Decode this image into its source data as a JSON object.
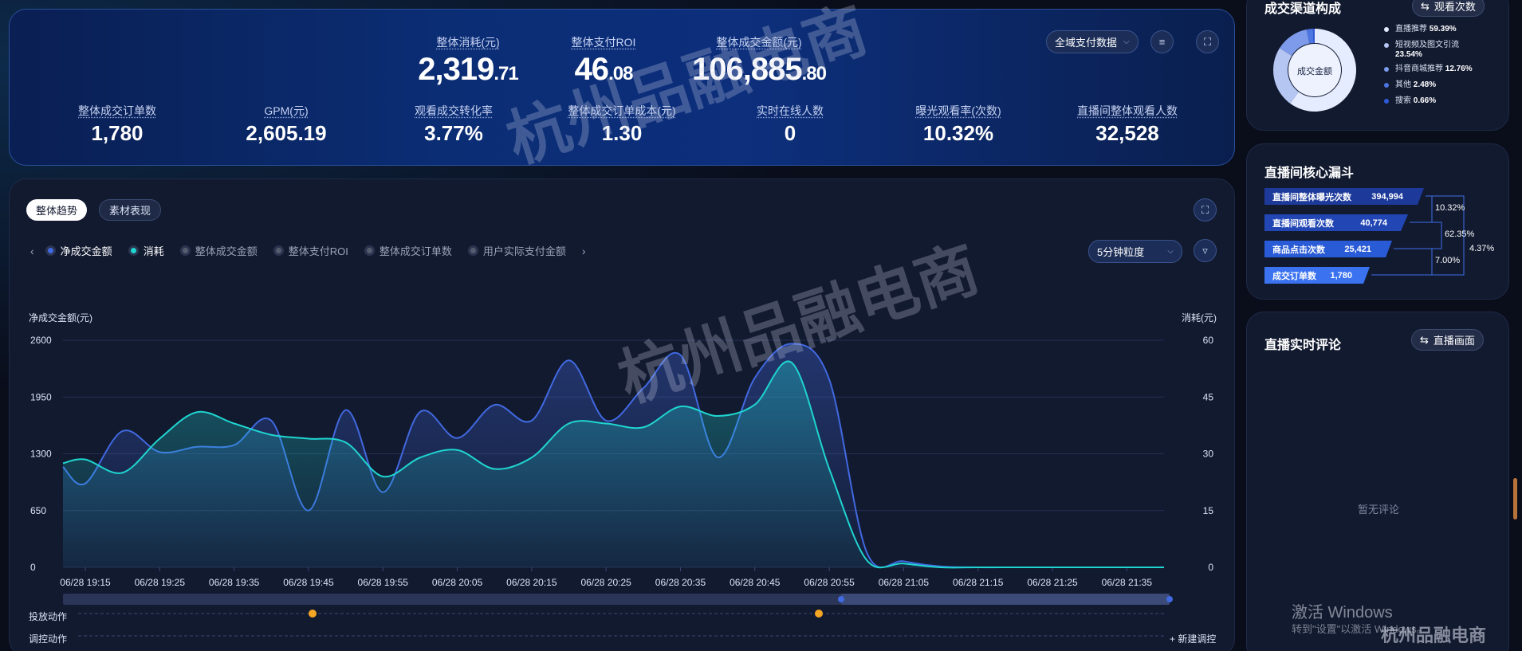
{
  "kpi": {
    "hero": [
      {
        "label": "整体消耗(元)",
        "int": "2,319",
        "dec": ".71"
      },
      {
        "label": "整体支付ROI",
        "int": "46",
        "dec": ".08"
      },
      {
        "label": "整体成交金额(元)",
        "int": "106,885",
        "dec": ".80"
      }
    ],
    "metrics": [
      {
        "label": "整体成交订单数",
        "value": "1,780"
      },
      {
        "label": "GPM(元)",
        "value": "2,605.19"
      },
      {
        "label": "观看成交转化率",
        "value": "3.77%"
      },
      {
        "label": "整体成交订单成本(元)",
        "value": "1.30"
      },
      {
        "label": "实时在线人数",
        "value": "0"
      },
      {
        "label": "曝光观看率(次数)",
        "value": "10.32%"
      },
      {
        "label": "直播间整体观看人数",
        "value": "32,528"
      }
    ],
    "scope_dropdown": "全域支付数据"
  },
  "trend": {
    "tabs": [
      "整体趋势",
      "素材表现"
    ],
    "legend": [
      {
        "name": "净成交金额",
        "color": "#4169e1",
        "active": true
      },
      {
        "name": "消耗",
        "color": "#1fd5d0",
        "active": true
      },
      {
        "name": "整体成交金额",
        "color": "#555c6e",
        "active": false
      },
      {
        "name": "整体支付ROI",
        "color": "#555c6e",
        "active": false
      },
      {
        "name": "整体成交订单数",
        "color": "#555c6e",
        "active": false
      },
      {
        "name": "用户实际支付金额",
        "color": "#555c6e",
        "active": false
      }
    ],
    "granularity": "5分钟粒度",
    "action_rows": [
      "投放动作",
      "调控动作"
    ],
    "new_adjust": "新建调控"
  },
  "chart_data": {
    "type": "line",
    "title": "",
    "ylabel_left": "净成交金额(元)",
    "ylabel_right": "消耗(元)",
    "ylim_left": [
      0,
      2600
    ],
    "ylim_right": [
      0,
      60
    ],
    "yticks_left": [
      "2600",
      "1950",
      "1300",
      "650",
      "0"
    ],
    "yticks_right": [
      "60",
      "45",
      "30",
      "15",
      "0"
    ],
    "xticks": [
      "06/28 19:15",
      "06/28 19:25",
      "06/28 19:35",
      "06/28 19:45",
      "06/28 19:55",
      "06/28 20:05",
      "06/28 20:15",
      "06/28 20:25",
      "06/28 20:35",
      "06/28 20:45",
      "06/28 20:55",
      "06/28 21:05",
      "06/28 21:15",
      "06/28 21:25",
      "06/28 21:35"
    ],
    "x": [
      "19:12",
      "19:15",
      "19:20",
      "19:25",
      "19:30",
      "19:35",
      "19:40",
      "19:45",
      "19:50",
      "19:55",
      "20:00",
      "20:05",
      "20:10",
      "20:15",
      "20:20",
      "20:25",
      "20:30",
      "20:35",
      "20:40",
      "20:45",
      "20:50",
      "20:55",
      "21:00",
      "21:05",
      "21:10",
      "21:15",
      "21:20",
      "21:25",
      "21:30",
      "21:35",
      "21:40"
    ],
    "series": [
      {
        "name": "净成交金额",
        "axis": "left",
        "color": "#4169e1",
        "values": [
          1150,
          960,
          1560,
          1320,
          1380,
          1400,
          1680,
          650,
          1800,
          860,
          1780,
          1480,
          1860,
          1680,
          2370,
          1680,
          2050,
          2430,
          1260,
          2170,
          2560,
          2150,
          180,
          70,
          10,
          0,
          0,
          0,
          0,
          0,
          0
        ]
      },
      {
        "name": "消耗",
        "axis": "right",
        "color": "#1fd5d0",
        "values": [
          27.5,
          28.5,
          25,
          34,
          41,
          38,
          35,
          34,
          33,
          24,
          29,
          31,
          26,
          29,
          38,
          38,
          37,
          42.5,
          40,
          43,
          54,
          26,
          2,
          1,
          0,
          0,
          0,
          0,
          0,
          0,
          0
        ]
      }
    ],
    "grid": true
  },
  "channel": {
    "title": "成交渠道构成",
    "toggle": "观看次数",
    "center_label": "成交金额",
    "items": [
      {
        "name": "直播推荐",
        "pct": "59.39%",
        "color": "#e6ecff"
      },
      {
        "name": "短视频及图文引流",
        "pct": "23.54%",
        "color": "#b6c6f3"
      },
      {
        "name": "抖音商城推荐",
        "pct": "12.76%",
        "color": "#7d9bea"
      },
      {
        "name": "其他",
        "pct": "2.48%",
        "color": "#4d76e3"
      },
      {
        "name": "搜索",
        "pct": "0.66%",
        "color": "#2f5ad8"
      }
    ],
    "share": [
      59.39,
      23.54,
      12.76,
      2.48,
      0.66
    ]
  },
  "funnel": {
    "title": "直播间核心漏斗",
    "rows": [
      {
        "name": "直播间整体曝光次数",
        "value": "394,994",
        "color": "#1d3a9a"
      },
      {
        "name": "直播间观看次数",
        "value": "40,774",
        "color": "#2247b5"
      },
      {
        "name": "商品点击次数",
        "value": "25,421",
        "color": "#2a5bd6"
      },
      {
        "name": "成交订单数",
        "value": "1,780",
        "color": "#3a72f0"
      }
    ],
    "rates": [
      "10.32%",
      "62.35%",
      "7.00%",
      "4.37%"
    ]
  },
  "comments": {
    "title": "直播实时评论",
    "toggle": "直播画面",
    "empty": "暂无评论"
  },
  "watermark": "杭州品融电商",
  "activate": {
    "title": "激活 Windows",
    "sub": "转到\"设置\"以激活 Windows。"
  }
}
